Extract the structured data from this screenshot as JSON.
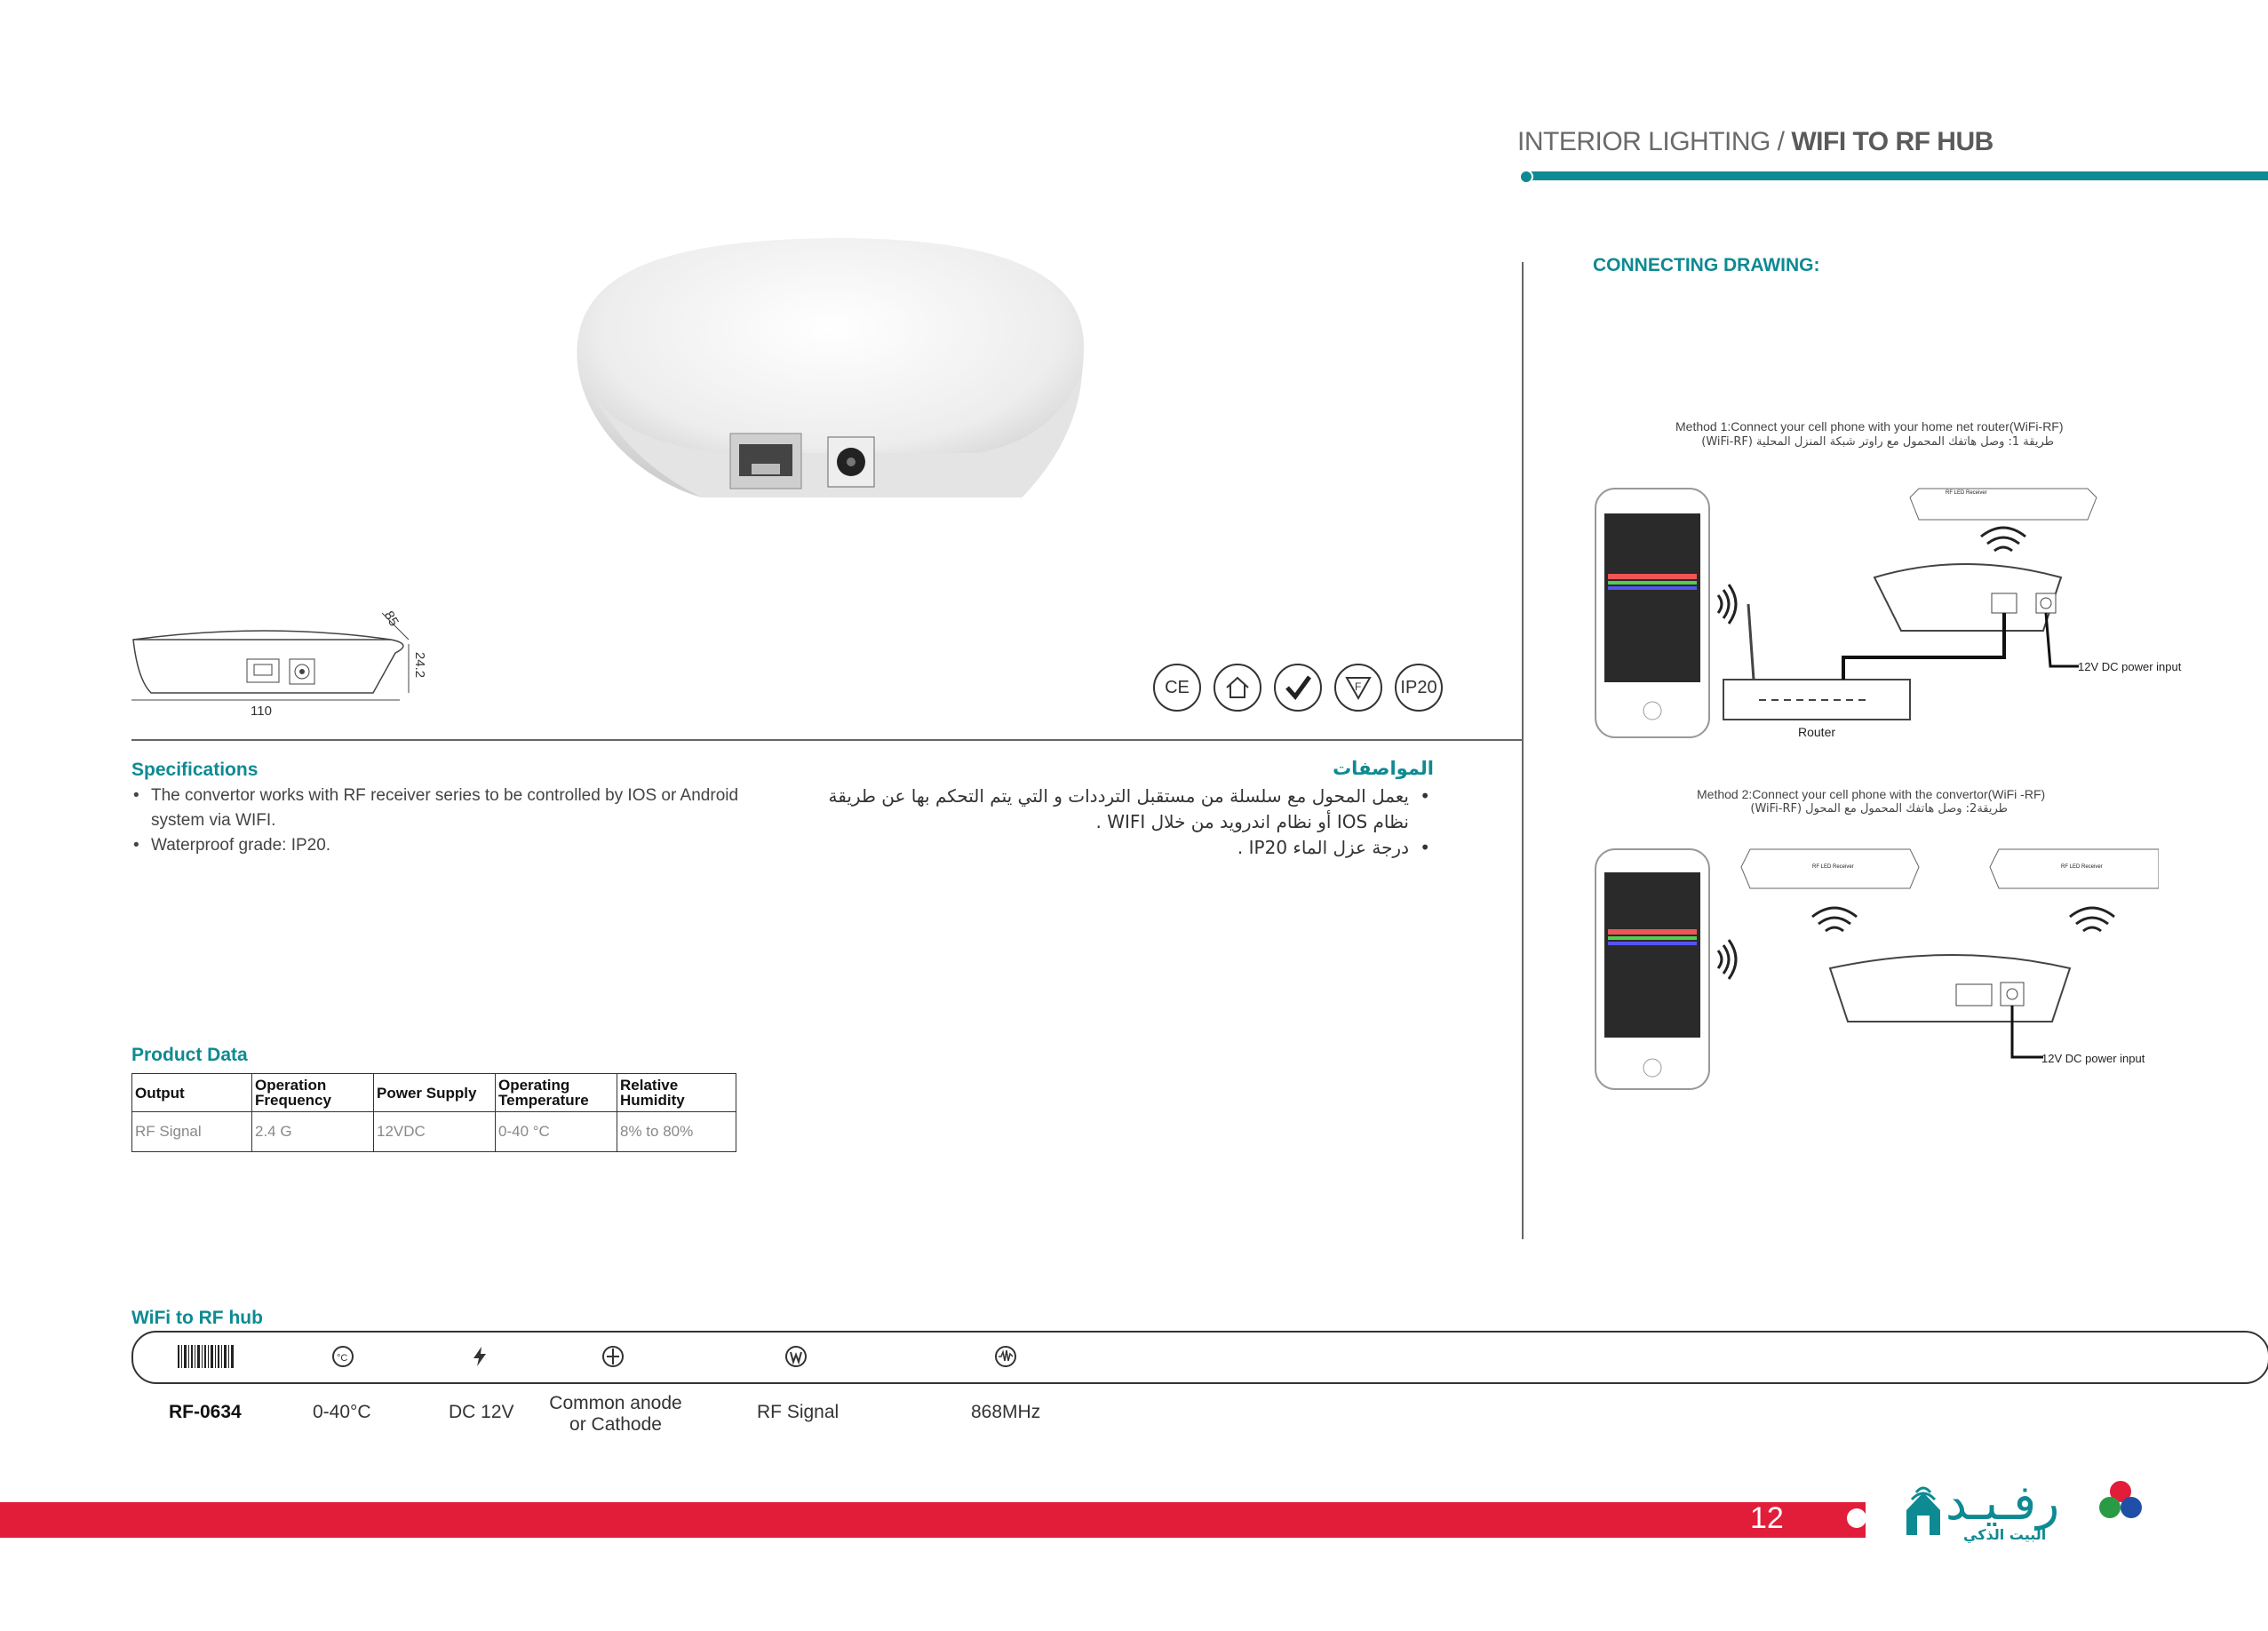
{
  "header": {
    "category": "INTERIOR LIGHTING / ",
    "product": "WIFI TO RF HUB"
  },
  "dimensions": {
    "depth": "85",
    "height": "24.2",
    "width": "110"
  },
  "certifications": [
    "CE",
    "home",
    "RoHS",
    "F",
    "IP20"
  ],
  "specifications": {
    "title": "Specifications",
    "items": [
      "The convertor works with RF receiver series to be controlled by  IOS  or  Android system via WIFI.",
      "Waterproof grade: IP20."
    ]
  },
  "specifications_ar": {
    "title": "المواصفات",
    "items": [
      "يعمل المحول مع سلسلة من مستقبل الترددات و التي يتم التحكم بها عن طريقة نظام IOS  أو نظام اندرويد من خلال WIFI .",
      "درجة عزل الماء IP20 ."
    ]
  },
  "product_data": {
    "title": "Product Data",
    "headers": [
      "Output",
      "Operation Frequency",
      "Power Supply",
      "Operating Temperature",
      "Relative Humidity"
    ],
    "row": [
      "RF Signal",
      "2.4 G",
      "12VDC",
      "0-40 °C",
      "8% to 80%"
    ]
  },
  "connecting": {
    "title": "CONNECTING DRAWING:",
    "method1": "Method 1:Connect your cell phone with your home net router(WiFi-RF)",
    "method1_ar": "طريقة 1: وصل هاتفك المحمول مع راوتر شبكة المنزل المحلية (WiFi-RF)",
    "method2": "Method 2:Connect your cell phone with the convertor(WiFi -RF)",
    "method2_ar": "طريقة2: وصل هاتفك المحمول مع المحول (WiFi-RF)",
    "router": "Router",
    "power1": "12V DC power input",
    "power2": "12V DC power input",
    "receiver": "RF LED Receiver"
  },
  "model": {
    "title": "WiFi to RF hub",
    "code": "RF-0634",
    "temperature": "0-40°C",
    "voltage": "DC 12V",
    "anode": "Common anode or Cathode",
    "signal": "RF Signal",
    "frequency": "868MHz"
  },
  "footer": {
    "page": "12",
    "brand": "رفـيـد",
    "brand_sub": "البيت الذكي"
  },
  "colors": {
    "teal": "#0e8a93",
    "red": "#e11d3a"
  }
}
